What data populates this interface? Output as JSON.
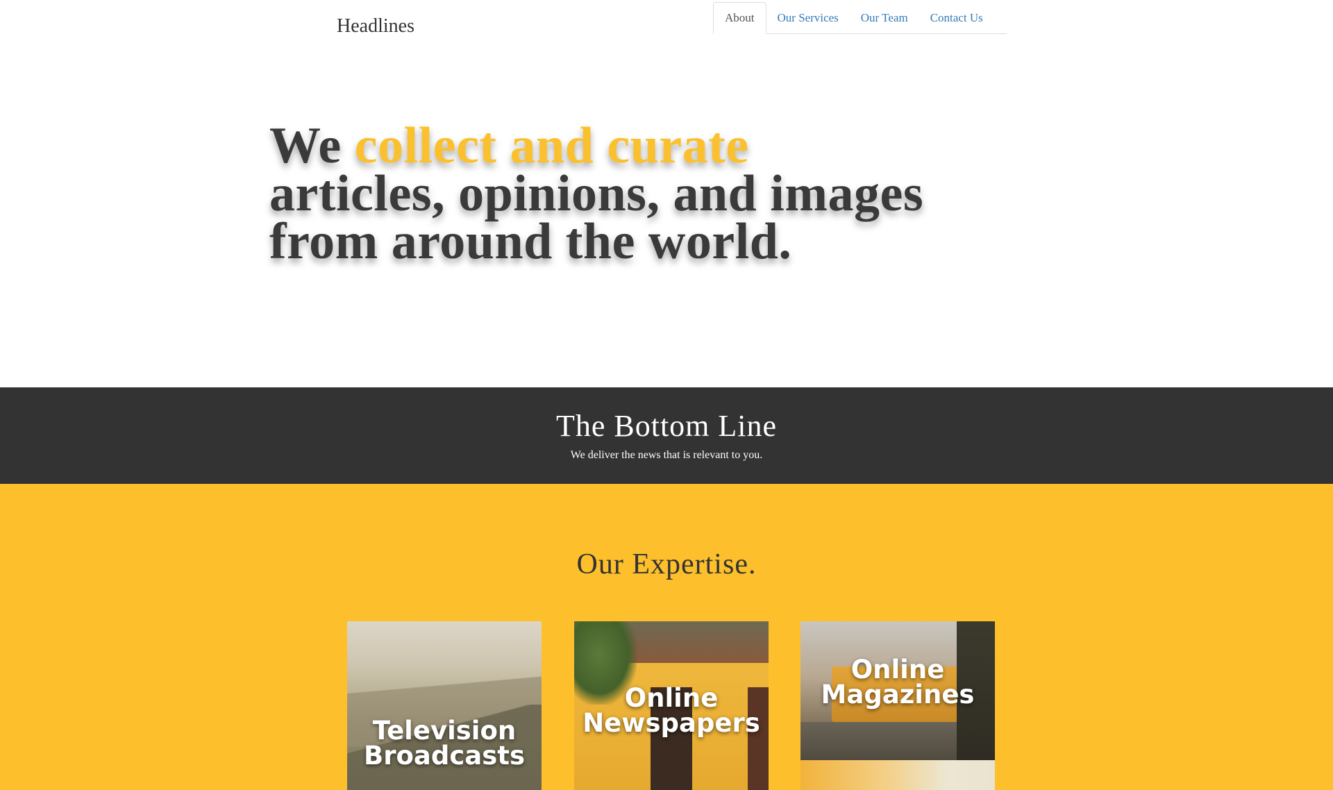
{
  "header": {
    "brand": "Headlines",
    "nav": [
      {
        "label": "About",
        "active": true
      },
      {
        "label": "Our Services",
        "active": false
      },
      {
        "label": "Our Team",
        "active": false
      },
      {
        "label": "Contact Us",
        "active": false
      }
    ]
  },
  "hero": {
    "lead": "We ",
    "accent": "collect and curate",
    "line2": "articles, opinions, and images",
    "line3": "from around the world."
  },
  "band": {
    "title": "The Bottom Line",
    "subtitle": "We deliver the news that is relevant to you."
  },
  "expertise": {
    "title": "Our Expertise.",
    "cards": [
      {
        "label_line1": "Television",
        "label_line2": "Broadcasts"
      },
      {
        "label_line1": "Online",
        "label_line2": "Newspapers"
      },
      {
        "label_line1": "Online",
        "label_line2": "Magazines"
      }
    ]
  },
  "colors": {
    "accent": "#fbc02d",
    "band_bg": "#333333",
    "expertise_bg": "#fdc02c",
    "link": "#337ab7"
  }
}
